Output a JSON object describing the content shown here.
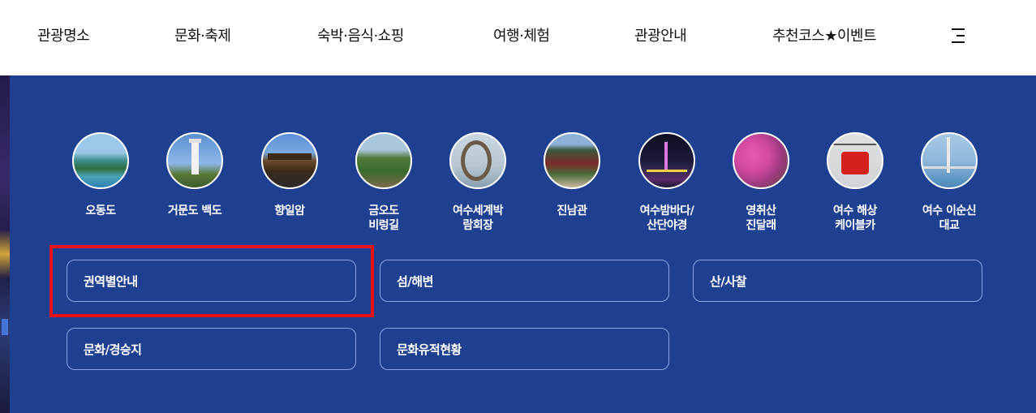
{
  "nav": {
    "items": [
      "관광명소",
      "문화·축제",
      "숙박·음식·쇼핑",
      "여행·체험",
      "관광안내",
      "추천코스★이벤트"
    ],
    "menu_icon": "hamburger-menu-icon"
  },
  "spots": [
    {
      "label": "오동도",
      "image": "island-photo"
    },
    {
      "label": "거문도 백도",
      "image": "lighthouse-photo"
    },
    {
      "label": "향일암",
      "image": "temple-photo"
    },
    {
      "label": "금오도\n비렁길",
      "image": "coastal-trail-photo"
    },
    {
      "label": "여수세계박\n람회장",
      "image": "expo-ring-photo"
    },
    {
      "label": "진남관",
      "image": "pavilion-photo"
    },
    {
      "label": "여수밤바다/\n산단야경",
      "image": "night-bridge-photo"
    },
    {
      "label": "영취산\n진달래",
      "image": "azalea-photo"
    },
    {
      "label": "여수 해상\n케이블카",
      "image": "cable-car-photo"
    },
    {
      "label": "여수 이순신\n대교",
      "image": "bridge-photo"
    }
  ],
  "categories": [
    "권역별안내",
    "섬/해변",
    "산/사찰",
    "문화/경승지",
    "문화유적현황"
  ],
  "colors": {
    "panel": "#1f4090",
    "highlight": "#e81010",
    "button_border": "#8aa4e6"
  }
}
